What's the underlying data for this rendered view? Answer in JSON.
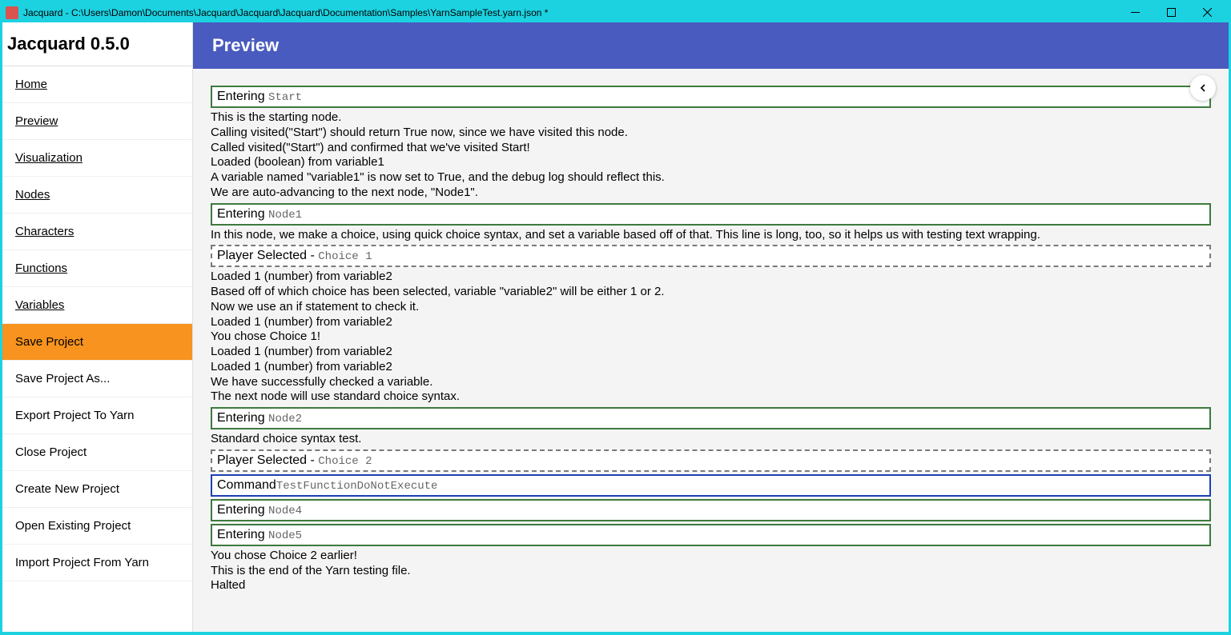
{
  "window": {
    "title": "Jacquard - C:\\Users\\Damon\\Documents\\Jacquard\\Jacquard\\Jacquard\\Documentation\\Samples\\YarnSampleTest.yarn.json *"
  },
  "sidebar": {
    "title": "Jacquard 0.5.0",
    "items": [
      {
        "label": "Home",
        "link": true
      },
      {
        "label": "Preview",
        "link": true
      },
      {
        "label": "Visualization",
        "link": true
      },
      {
        "label": "Nodes",
        "link": true
      },
      {
        "label": "Characters",
        "link": true
      },
      {
        "label": "Functions",
        "link": true
      },
      {
        "label": "Variables",
        "link": true
      },
      {
        "label": "Save Project",
        "link": false,
        "active": true
      },
      {
        "label": "Save Project As...",
        "link": false
      },
      {
        "label": "Export Project To Yarn",
        "link": false
      },
      {
        "label": "Close Project",
        "link": false
      },
      {
        "label": "Create New Project",
        "link": false
      },
      {
        "label": "Open Existing Project",
        "link": false
      },
      {
        "label": "Import Project From Yarn",
        "link": false
      }
    ]
  },
  "header": {
    "title": "Preview"
  },
  "log": {
    "enteringLabel": "Entering ",
    "selectedLabel": "Player Selected - ",
    "commandLabel": "Command",
    "entries": [
      {
        "type": "entering",
        "node": "Start"
      },
      {
        "type": "text",
        "text": "This is the starting node."
      },
      {
        "type": "text",
        "text": "Calling visited(\"Start\") should return True now, since we have visited this node."
      },
      {
        "type": "text",
        "text": "Called visited(\"Start\") and confirmed that we've visited Start!"
      },
      {
        "type": "text",
        "text": "Loaded (boolean) from variable1"
      },
      {
        "type": "text",
        "text": "A variable named \"variable1\" is now set to True, and the debug log should reflect this."
      },
      {
        "type": "text",
        "text": "We are auto-advancing to the next node, \"Node1\"."
      },
      {
        "type": "entering",
        "node": "Node1"
      },
      {
        "type": "text",
        "text": "In this node, we make a choice, using quick choice syntax, and set a variable based off of that. This line is long, too, so it helps us with testing text wrapping."
      },
      {
        "type": "selected",
        "choice": "Choice 1"
      },
      {
        "type": "text",
        "text": "Loaded 1 (number) from variable2"
      },
      {
        "type": "text",
        "text": "Based off of which choice has been selected, variable \"variable2\" will be either 1 or 2."
      },
      {
        "type": "text",
        "text": "Now we use an if statement to check it."
      },
      {
        "type": "text",
        "text": "Loaded 1 (number) from variable2"
      },
      {
        "type": "text",
        "text": "You chose Choice 1!"
      },
      {
        "type": "text",
        "text": "Loaded 1 (number) from variable2"
      },
      {
        "type": "text",
        "text": "Loaded 1 (number) from variable2"
      },
      {
        "type": "text",
        "text": "We have successfully checked a variable."
      },
      {
        "type": "text",
        "text": "The next node will use standard choice syntax."
      },
      {
        "type": "entering",
        "node": "Node2"
      },
      {
        "type": "text",
        "text": "Standard choice syntax test."
      },
      {
        "type": "selected",
        "choice": "Choice 2"
      },
      {
        "type": "command",
        "command": "TestFunctionDoNotExecute"
      },
      {
        "type": "entering",
        "node": "Node4"
      },
      {
        "type": "entering",
        "node": "Node5"
      },
      {
        "type": "text",
        "text": "You chose Choice 2 earlier!"
      },
      {
        "type": "text",
        "text": "This is the end of the Yarn testing file."
      },
      {
        "type": "text",
        "text": "Halted"
      }
    ]
  }
}
